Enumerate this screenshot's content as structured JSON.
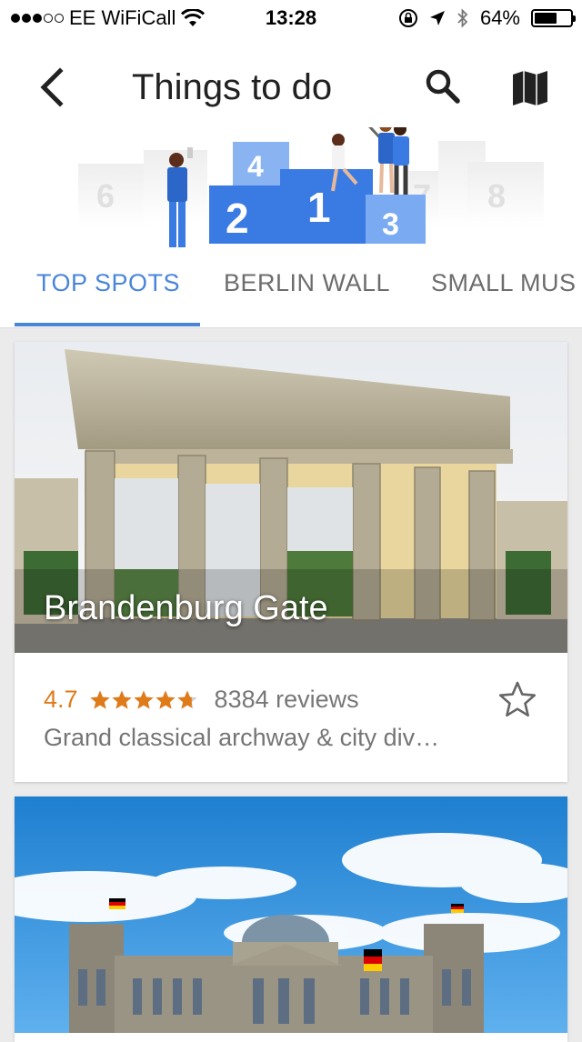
{
  "status_bar": {
    "carrier": "EE WiFiCall",
    "time": "13:28",
    "battery": "64%",
    "battery_level": 0.64,
    "signal_bars_filled": 3,
    "signal_bars_total": 5
  },
  "header": {
    "title": "Things to do",
    "icons": [
      "back-arrow-icon",
      "search-icon",
      "map-icon"
    ]
  },
  "illustration": {
    "podium_labels": [
      "1",
      "2",
      "3",
      "4"
    ],
    "side_labels": [
      "6",
      "7",
      "8"
    ]
  },
  "tabs": [
    {
      "label": "TOP SPOTS",
      "active": true
    },
    {
      "label": "BERLIN WALL",
      "active": false
    },
    {
      "label": "SMALL MUS",
      "active": false
    }
  ],
  "cards": [
    {
      "name": "Brandenburg Gate",
      "rating": "4.7",
      "rating_value": 4.7,
      "reviews": "8384 reviews",
      "description": "Grand classical archway & city div…"
    },
    {
      "name": "",
      "image": "reichstag-photo"
    }
  ],
  "colors": {
    "accent": "#4a86d8",
    "rating": "#e07b1a",
    "background": "#ebebeb"
  }
}
